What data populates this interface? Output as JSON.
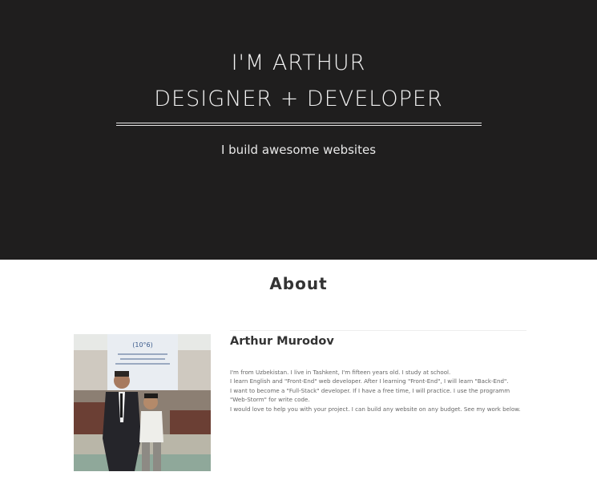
{
  "hero": {
    "line1": "I'M ARTHUR",
    "line2": "DESIGNER + DEVELOPER",
    "tagline": "I build awesome websites"
  },
  "about": {
    "title": "About",
    "name": "Arthur Murodov",
    "bio": [
      "I'm from Uzbekistan. I live in Tashkent, I'm fifteen years old. I study at school.",
      "I learn English and \"Front-End\" web developer. After I learning \"Front-End\", I will learn \"Back-End\".",
      "I want to become a \"Full-Stack\" developer. If I have a free time, I will practice. I use the programm",
      "\"Web-Storm\" for write code.",
      "I would love to help you with your project. I can build any website on any budget. See my work below."
    ],
    "photo_banner": "(10°6)"
  },
  "colors": {
    "hero_background": "#1f1e1e",
    "hero_text": "#f2f2f2",
    "page_background": "#ffffff"
  }
}
